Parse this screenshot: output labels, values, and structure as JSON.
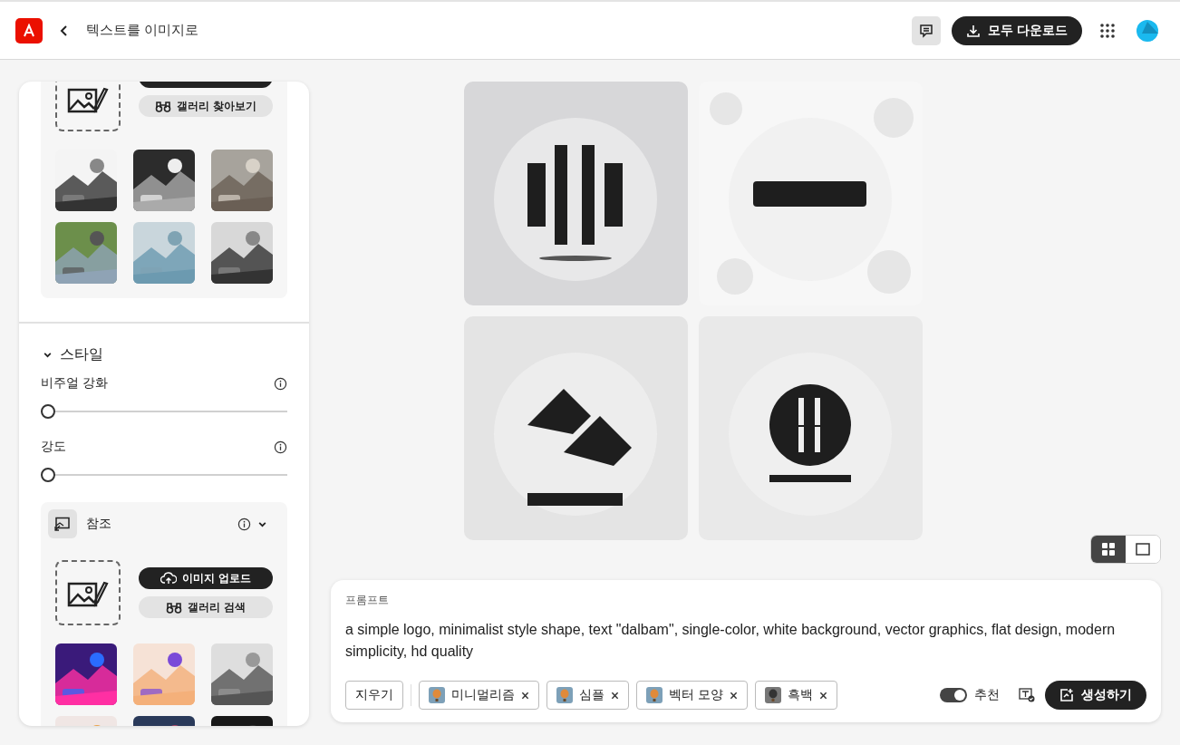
{
  "header": {
    "title": "텍스트를 이미지로",
    "download_all": "모두 다운로드"
  },
  "sidebar": {
    "top_section": {
      "gallery_button": "갤러리 찾아보기"
    },
    "style_section": {
      "title": "스타일",
      "expanded": true,
      "sliders": [
        {
          "label": "비주얼 강화",
          "level": 0
        },
        {
          "label": "강도",
          "level": 0
        }
      ]
    },
    "reference": {
      "title": "참조",
      "expanded": true,
      "upload_button": "이미지 업로드",
      "gallery_button": "갤러리 검색"
    }
  },
  "view_toggle": [
    {
      "kind": "grid",
      "selected": true
    },
    {
      "kind": "single",
      "selected": false
    }
  ],
  "prompt": {
    "label": "프롬프트",
    "text": "a simple logo, minimalist style shape, text \"dalbam\", single-color, white background, vector graphics, flat design, modern simplicity, hd quality",
    "clear_button": "지우기",
    "chips": [
      {
        "label": "미니멀리즘"
      },
      {
        "label": "심플"
      },
      {
        "label": "벡터 모양"
      },
      {
        "label": "흑백"
      }
    ],
    "suggest": {
      "label": "추천",
      "on": true
    },
    "generate_button": "생성하기"
  }
}
